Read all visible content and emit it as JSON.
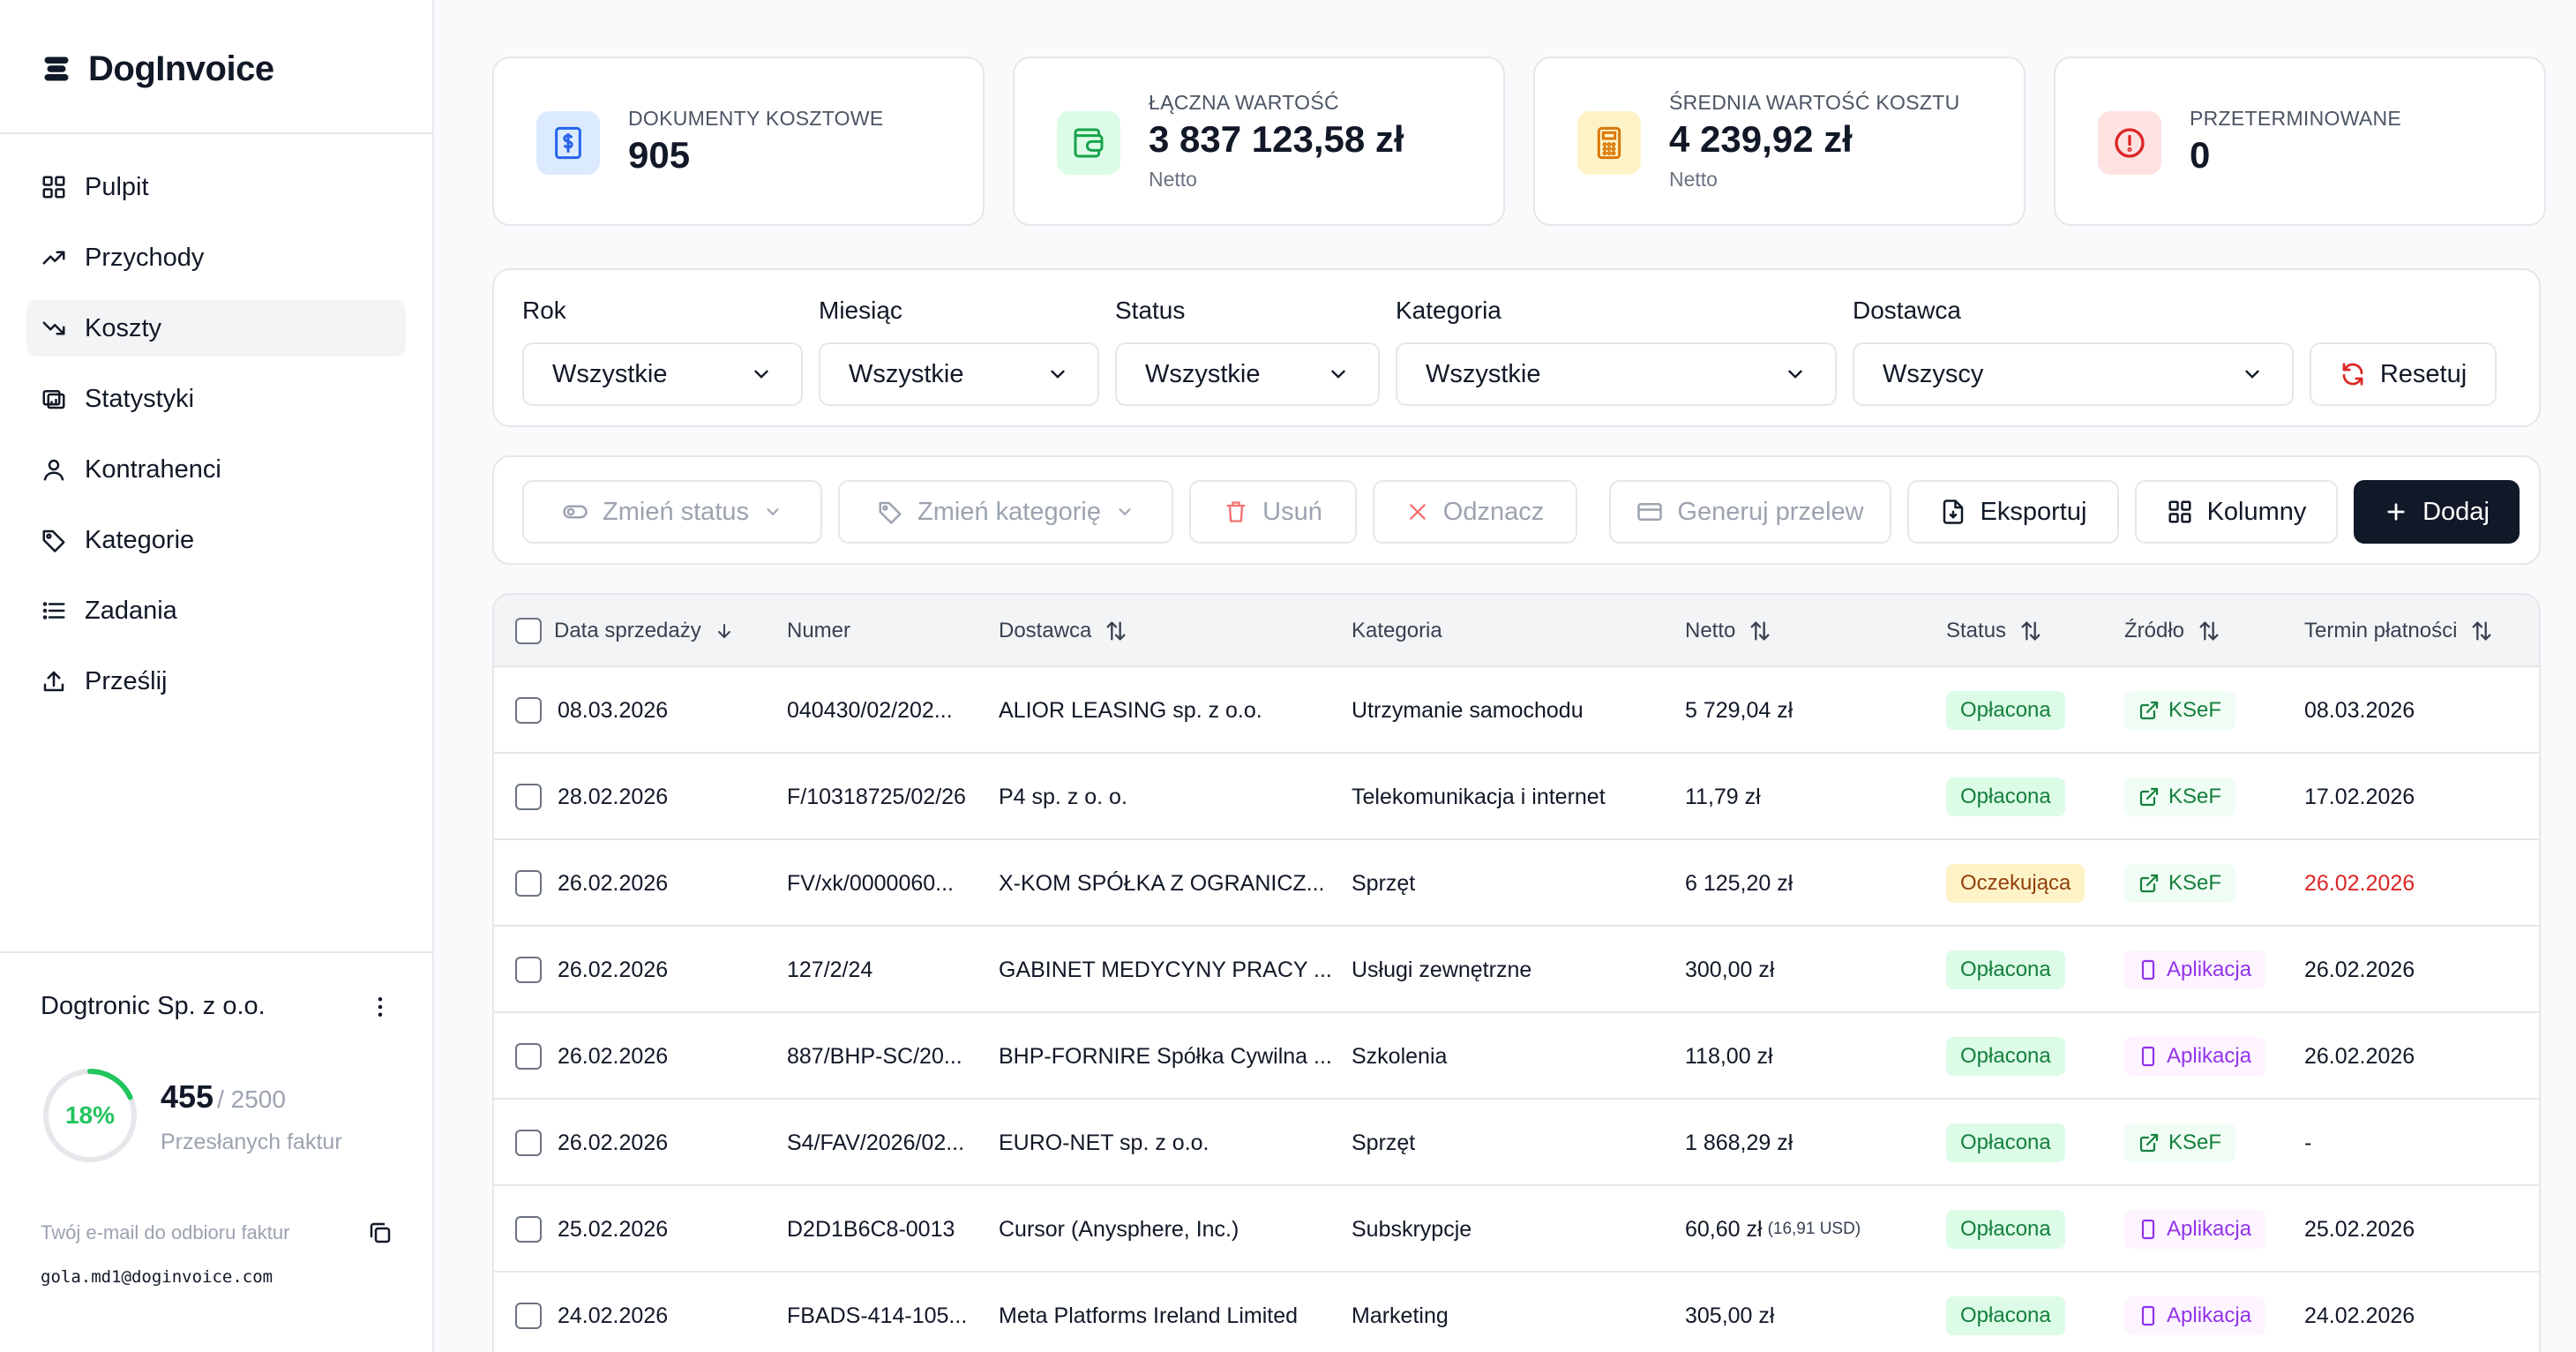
{
  "brand": {
    "name": "DogInvoice"
  },
  "nav": [
    {
      "label": "Pulpit",
      "icon": "grid-icon",
      "active": false
    },
    {
      "label": "Przychody",
      "icon": "trending-up-icon",
      "active": false
    },
    {
      "label": "Koszty",
      "icon": "trending-down-icon",
      "active": true
    },
    {
      "label": "Statystyki",
      "icon": "chart-icon",
      "active": false
    },
    {
      "label": "Kontrahenci",
      "icon": "user-icon",
      "active": false
    },
    {
      "label": "Kategorie",
      "icon": "tag-icon",
      "active": false
    },
    {
      "label": "Zadania",
      "icon": "list-icon",
      "active": false
    },
    {
      "label": "Prześlij",
      "icon": "upload-icon",
      "active": false
    }
  ],
  "account": {
    "company": "Dogtronic Sp. z o.o.",
    "usage_percent_label": "18%",
    "usage_fraction": 0.182,
    "usage_count": "455",
    "usage_total": "/ 2500",
    "usage_label": "Przesłanych faktur",
    "email_label": "Twój e-mail do odbioru faktur",
    "email": "gola.md1@doginvoice.com"
  },
  "stats": [
    {
      "label": "DOKUMENTY KOSZTOWE",
      "value": "905",
      "sub": "",
      "icon": "dollar-document-icon",
      "bg": "#dbeafe",
      "fg": "#2563eb"
    },
    {
      "label": "ŁĄCZNA WARTOŚĆ",
      "value": "3 837 123,58 zł",
      "sub": "Netto",
      "icon": "wallet-icon",
      "bg": "#dcfce7",
      "fg": "#16a34a"
    },
    {
      "label": "ŚREDNIA WARTOŚĆ KOSZTU",
      "value": "4 239,92 zł",
      "sub": "Netto",
      "icon": "calculator-icon",
      "bg": "#fef3c7",
      "fg": "#d97706"
    },
    {
      "label": "PRZETERMINOWANE",
      "value": "0",
      "sub": "",
      "icon": "alert-circle-icon",
      "bg": "#fee2e2",
      "fg": "#dc2626"
    }
  ],
  "filters": {
    "rok": {
      "label": "Rok",
      "value": "Wszystkie"
    },
    "miesiac": {
      "label": "Miesiąc",
      "value": "Wszystkie"
    },
    "status": {
      "label": "Status",
      "value": "Wszystkie"
    },
    "kategoria": {
      "label": "Kategoria",
      "value": "Wszystkie"
    },
    "dostawca": {
      "label": "Dostawca",
      "value": "Wszyscy"
    },
    "reset_label": "Resetuj"
  },
  "actions": {
    "change_status": "Zmień status",
    "change_category": "Zmień kategorię",
    "delete": "Usuń",
    "deselect": "Odznacz",
    "generate_transfer": "Generuj przelew",
    "export": "Eksportuj",
    "columns": "Kolumny",
    "add": "Dodaj"
  },
  "table": {
    "headers": {
      "date": "Data sprzedaży",
      "number": "Numer",
      "supplier": "Dostawca",
      "category": "Kategoria",
      "net": "Netto",
      "status": "Status",
      "source": "Źródło",
      "due": "Termin płatności"
    },
    "rows": [
      {
        "date": "08.03.2026",
        "number": "040430/02/202...",
        "supplier": "ALIOR LEASING sp. z o.o.",
        "category": "Utrzymanie samochodu",
        "net": "5 729,04 zł",
        "net_extra": "",
        "status": "Opłacona",
        "status_type": "paid",
        "source": "KSeF",
        "source_type": "ksef",
        "due": "08.03.2026",
        "overdue": false
      },
      {
        "date": "28.02.2026",
        "number": "F/10318725/02/26",
        "supplier": "P4 sp. z o. o.",
        "category": "Telekomunikacja i internet",
        "net": "11,79 zł",
        "net_extra": "",
        "status": "Opłacona",
        "status_type": "paid",
        "source": "KSeF",
        "source_type": "ksef",
        "due": "17.02.2026",
        "overdue": false
      },
      {
        "date": "26.02.2026",
        "number": "FV/xk/0000060...",
        "supplier": "X-KOM SPÓŁKA Z OGRANICZ...",
        "category": "Sprzęt",
        "net": "6 125,20 zł",
        "net_extra": "",
        "status": "Oczekująca",
        "status_type": "pending",
        "source": "KSeF",
        "source_type": "ksef",
        "due": "26.02.2026",
        "overdue": true
      },
      {
        "date": "26.02.2026",
        "number": "127/2/24",
        "supplier": "GABINET MEDYCYNY PRACY ...",
        "category": "Usługi zewnętrzne",
        "net": "300,00 zł",
        "net_extra": "",
        "status": "Opłacona",
        "status_type": "paid",
        "source": "Aplikacja",
        "source_type": "app",
        "due": "26.02.2026",
        "overdue": false
      },
      {
        "date": "26.02.2026",
        "number": "887/BHP-SC/20...",
        "supplier": "BHP-FORNIRE Spółka Cywilna ...",
        "category": "Szkolenia",
        "net": "118,00 zł",
        "net_extra": "",
        "status": "Opłacona",
        "status_type": "paid",
        "source": "Aplikacja",
        "source_type": "app",
        "due": "26.02.2026",
        "overdue": false
      },
      {
        "date": "26.02.2026",
        "number": "S4/FAV/2026/02...",
        "supplier": "EURO-NET sp. z o.o.",
        "category": "Sprzęt",
        "net": "1 868,29 zł",
        "net_extra": "",
        "status": "Opłacona",
        "status_type": "paid",
        "source": "KSeF",
        "source_type": "ksef",
        "due": "-",
        "overdue": false
      },
      {
        "date": "25.02.2026",
        "number": "D2D1B6C8-0013",
        "supplier": "Cursor (Anysphere, Inc.)",
        "category": "Subskrypcje",
        "net": "60,60 zł",
        "net_extra": "(16,91 USD)",
        "status": "Opłacona",
        "status_type": "paid",
        "source": "Aplikacja",
        "source_type": "app",
        "due": "25.02.2026",
        "overdue": false
      },
      {
        "date": "24.02.2026",
        "number": "FBADS-414-105...",
        "supplier": "Meta Platforms Ireland Limited",
        "category": "Marketing",
        "net": "305,00 zł",
        "net_extra": "",
        "status": "Opłacona",
        "status_type": "paid",
        "source": "Aplikacja",
        "source_type": "app",
        "due": "24.02.2026",
        "overdue": false
      }
    ]
  }
}
